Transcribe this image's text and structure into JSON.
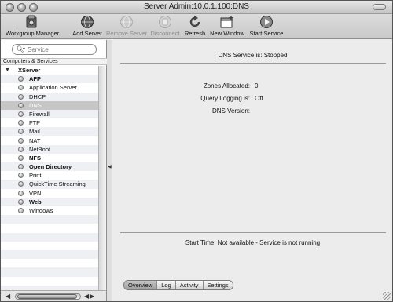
{
  "window": {
    "title": "Server Admin:10.0.1.100:DNS"
  },
  "toolbar": {
    "items": [
      {
        "label": "Workgroup Manager",
        "icon": "workgroup-manager-icon",
        "enabled": true
      },
      {
        "label": "Add Server",
        "icon": "add-server-icon",
        "enabled": true
      },
      {
        "label": "Remove Server",
        "icon": "remove-server-icon",
        "enabled": false
      },
      {
        "label": "Disconnect",
        "icon": "disconnect-icon",
        "enabled": false
      },
      {
        "label": "Refresh",
        "icon": "refresh-icon",
        "enabled": true
      },
      {
        "label": "New Window",
        "icon": "new-window-icon",
        "enabled": true
      },
      {
        "label": "Start Service",
        "icon": "start-service-icon",
        "enabled": true
      }
    ]
  },
  "sidebar": {
    "search_placeholder": "Service",
    "header": "Computers & Services",
    "server": "XServer",
    "services": [
      {
        "label": "AFP",
        "bold": true,
        "selected": false
      },
      {
        "label": "Application Server",
        "bold": false,
        "selected": false
      },
      {
        "label": "DHCP",
        "bold": false,
        "selected": false
      },
      {
        "label": "DNS",
        "bold": false,
        "selected": true
      },
      {
        "label": "Firewall",
        "bold": false,
        "selected": false
      },
      {
        "label": "FTP",
        "bold": false,
        "selected": false
      },
      {
        "label": "Mail",
        "bold": false,
        "selected": false
      },
      {
        "label": "NAT",
        "bold": false,
        "selected": false
      },
      {
        "label": "NetBoot",
        "bold": false,
        "selected": false
      },
      {
        "label": "NFS",
        "bold": true,
        "selected": false
      },
      {
        "label": "Open Directory",
        "bold": true,
        "selected": false
      },
      {
        "label": "Print",
        "bold": false,
        "selected": false
      },
      {
        "label": "QuickTime Streaming",
        "bold": false,
        "selected": false
      },
      {
        "label": "VPN",
        "bold": false,
        "selected": false
      },
      {
        "label": "Web",
        "bold": true,
        "selected": false
      },
      {
        "label": "Windows",
        "bold": false,
        "selected": false
      }
    ]
  },
  "main": {
    "service_status": "DNS Service is:  Stopped",
    "info": [
      {
        "label": "Zones Allocated:",
        "value": "0"
      },
      {
        "label": "Query Logging is:",
        "value": "Off"
      },
      {
        "label": "DNS Version:",
        "value": ""
      }
    ],
    "start_time": "Start Time: Not available - Service is not running"
  },
  "tabs": [
    {
      "label": "Overview",
      "active": true
    },
    {
      "label": "Log",
      "active": false
    },
    {
      "label": "Activity",
      "active": false
    },
    {
      "label": "Settings",
      "active": false
    }
  ],
  "colors": {
    "window_bg": "#ececec",
    "selection_bg": "#c6c6c6",
    "row_stripe": "#eef0f4"
  }
}
